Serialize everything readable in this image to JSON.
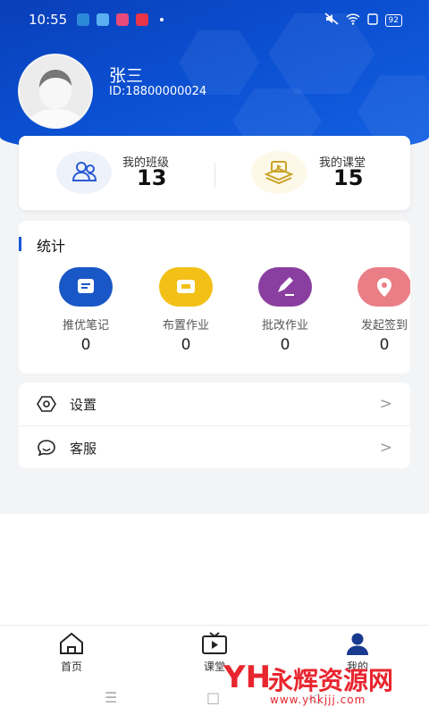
{
  "status_bar": {
    "time": "10:55",
    "battery": "92"
  },
  "profile": {
    "name": "张三",
    "id_text": "ID:18800000024"
  },
  "summary": {
    "classes_label": "我的班级",
    "classes_count": "13",
    "courses_label": "我的课堂",
    "courses_count": "15"
  },
  "stats": {
    "title": "统计",
    "items": [
      {
        "label": "推优笔记",
        "value": "0",
        "icon": "notes-icon",
        "color": "#1957c7"
      },
      {
        "label": "布置作业",
        "value": "0",
        "icon": "assign-homework-icon",
        "color": "#f3c018"
      },
      {
        "label": "批改作业",
        "value": "0",
        "icon": "grade-homework-icon",
        "color": "#8a3fa0"
      },
      {
        "label": "发起签到",
        "value": "0",
        "icon": "check-in-icon",
        "color": "#e97e86"
      }
    ]
  },
  "menu": {
    "settings_label": "设置",
    "service_label": "客服",
    "chevron": ">"
  },
  "tabs": {
    "home": "首页",
    "classroom": "课堂",
    "mine": "我的"
  },
  "watermark": {
    "name": "永辉资源网",
    "url": "www.yhkjjj.com"
  },
  "colors": {
    "header_blue": "#0b4fd1",
    "active_tab": "#1a3a8f"
  }
}
